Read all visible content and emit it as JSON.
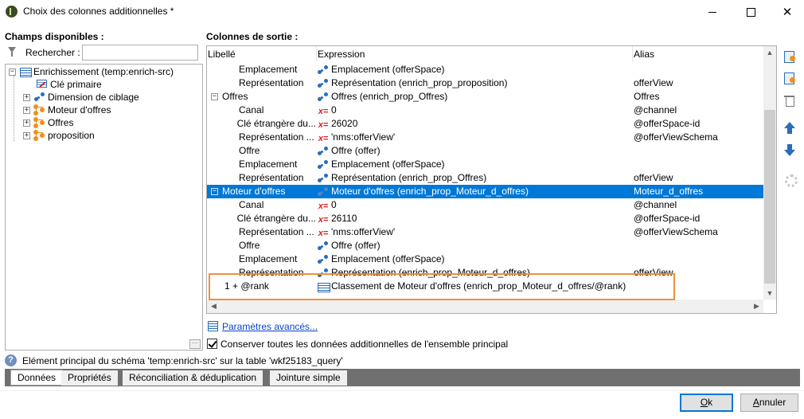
{
  "window": {
    "title": "Choix des colonnes additionnelles *",
    "controls": {
      "minimize": "minimize",
      "maximize": "maximize",
      "close": "✕"
    }
  },
  "left_panel": {
    "title": "Champs disponibles :",
    "search_label": "Rechercher :",
    "search_value": "",
    "tree": [
      {
        "label": "Enrichissement (temp:enrich-src)",
        "icon": "table-icon",
        "expander": "−"
      },
      {
        "label": "Clé primaire",
        "icon": "primary-key-icon",
        "expander": ""
      },
      {
        "label": "Dimension de ciblage",
        "icon": "link-icon",
        "expander": "+"
      },
      {
        "label": "Moteur d'offres",
        "icon": "collection-link-icon",
        "expander": "+"
      },
      {
        "label": "Offres",
        "icon": "collection-link-icon",
        "expander": "+"
      },
      {
        "label": "proposition",
        "icon": "collection-link-icon",
        "expander": "+"
      }
    ],
    "more_button": "···"
  },
  "right_panel": {
    "title": "Colonnes de sortie :",
    "columns": {
      "label": "Libellé",
      "expression": "Expression",
      "alias": "Alias"
    },
    "rows": [
      {
        "expander": "",
        "label": "Emplacement",
        "icon": "link",
        "expression": "Emplacement (offerSpace)",
        "alias": ""
      },
      {
        "expander": "",
        "label": "Représentation",
        "icon": "link",
        "expression": "Représentation (enrich_prop_proposition)",
        "alias": "offerView"
      },
      {
        "expander": "−",
        "label": "Offres",
        "icon": "link",
        "expression": "Offres (enrich_prop_Offres)",
        "alias": "Offres"
      },
      {
        "expander": "",
        "label": "Canal",
        "icon": "x",
        "expression": "0",
        "alias": "@channel"
      },
      {
        "expander": "",
        "label": "Clé étrangère du...",
        "icon": "x",
        "expression": "26020",
        "alias": "@offerSpace-id"
      },
      {
        "expander": "",
        "label": "Représentation ...",
        "icon": "x",
        "expression": "'nms:offerView'",
        "alias": "@offerViewSchema"
      },
      {
        "expander": "",
        "label": "Offre",
        "icon": "link",
        "expression": "Offre (offer)",
        "alias": ""
      },
      {
        "expander": "",
        "label": "Emplacement",
        "icon": "link",
        "expression": "Emplacement (offerSpace)",
        "alias": ""
      },
      {
        "expander": "",
        "label": "Représentation",
        "icon": "link",
        "expression": "Représentation (enrich_prop_Offres)",
        "alias": "offerView"
      },
      {
        "expander": "−",
        "label": "Moteur d'offres",
        "icon": "link",
        "expression": "Moteur d'offres (enrich_prop_Moteur_d_offres)",
        "alias": "Moteur_d_offres",
        "selected": true
      },
      {
        "expander": "",
        "label": "Canal",
        "icon": "x",
        "expression": "0",
        "alias": "@channel"
      },
      {
        "expander": "",
        "label": "Clé étrangère du...",
        "icon": "x",
        "expression": "26110",
        "alias": "@offerSpace-id"
      },
      {
        "expander": "",
        "label": "Représentation ...",
        "icon": "x",
        "expression": "'nms:offerView'",
        "alias": "@offerViewSchema"
      },
      {
        "expander": "",
        "label": "Offre",
        "icon": "link",
        "expression": "Offre (offer)",
        "alias": ""
      },
      {
        "expander": "",
        "label": "Emplacement",
        "icon": "link",
        "expression": "Emplacement (offerSpace)",
        "alias": ""
      },
      {
        "expander": "",
        "label": "Représentation",
        "icon": "link",
        "expression": "Représentation (enrich_prop_Moteur_d_offres)",
        "alias": "offerView"
      },
      {
        "expander": "",
        "label": "1 + @rank",
        "icon": "rank",
        "expression": "Classement de Moteur d'offres (enrich_prop_Moteur_d_offres/@rank)",
        "alias": ""
      }
    ],
    "x_glyph": "x=",
    "scroll": {
      "up": "▲",
      "down": "▼",
      "left": "◀",
      "right": "▶"
    },
    "toolbar": [
      "add-column-icon",
      "add-computed-column-icon",
      "delete-icon",
      "move-up-icon",
      "move-down-icon",
      "gear-icon"
    ]
  },
  "advanced_link": "Paramètres avancés...",
  "keep_checkbox": {
    "label": "Conserver toutes les données additionnelles de l'ensemble principal",
    "checked": true
  },
  "info_text": "Elément principal du schéma 'temp:enrich-src' sur la table 'wkf25183_query'",
  "info_glyph": "?",
  "tabs": [
    "Données",
    "Propriétés",
    "Réconciliation & déduplication",
    "Jointure simple"
  ],
  "active_tab": "Données",
  "buttons": {
    "ok_first": "O",
    "ok_rest": "k",
    "cancel_first": "A",
    "cancel_rest": "nnuler"
  },
  "colors": {
    "selection": "#0078d7",
    "highlight_box": "#f0913a",
    "link": "#0645c8"
  }
}
